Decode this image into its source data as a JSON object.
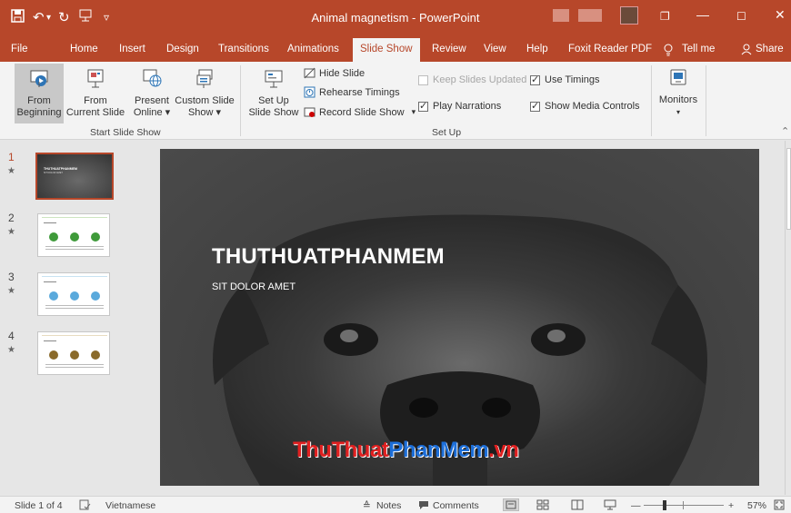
{
  "window": {
    "title": "Animal magnetism  -  PowerPoint",
    "controls": {
      "restore": "❐",
      "minimize": "—",
      "maximize": "☐",
      "close": "✕"
    },
    "qat": {
      "save_icon": "save-icon",
      "undo": "↶",
      "undo_drop": "▾",
      "repeat": "↻",
      "customize": "▿"
    }
  },
  "tabs": [
    {
      "label": "File"
    },
    {
      "label": "Home"
    },
    {
      "label": "Insert"
    },
    {
      "label": "Design"
    },
    {
      "label": "Transitions"
    },
    {
      "label": "Animations"
    },
    {
      "label": "Slide Show",
      "active": true
    },
    {
      "label": "Review"
    },
    {
      "label": "View"
    },
    {
      "label": "Help"
    },
    {
      "label": "Foxit Reader PDF"
    },
    {
      "label": "Tell me"
    },
    {
      "label": "Share"
    }
  ],
  "ribbon": {
    "start_group": {
      "label": "Start Slide Show",
      "from_beginning": {
        "line1": "From",
        "line2": "Beginning"
      },
      "from_current": {
        "line1": "From",
        "line2": "Current Slide"
      },
      "present_online": {
        "line1": "Present",
        "line2": "Online ▾"
      },
      "custom_show": {
        "line1": "Custom Slide",
        "line2": "Show ▾"
      }
    },
    "setup_group": {
      "label": "Set Up",
      "setup_show": {
        "line1": "Set Up",
        "line2": "Slide Show"
      },
      "hide_slide": "Hide Slide",
      "rehearse": "Rehearse Timings",
      "record": "Record Slide Show",
      "record_drop": "▾",
      "keep_updated": "Keep Slides Updated",
      "play_narrations": "Play Narrations",
      "use_timings": "Use Timings",
      "show_media": "Show Media Controls"
    },
    "monitors": {
      "label": "Monitors",
      "drop": "▾"
    },
    "collapse": "⌃"
  },
  "thumbnails": [
    {
      "num": "1",
      "star": "★",
      "current": true,
      "mini_title": "THUTHUATPHANMEM",
      "mini_sub": "SIT DOLOR AMET"
    },
    {
      "num": "2",
      "star": "★",
      "dots": [
        "#3f9a3a",
        "#3f9a3a",
        "#3f9a3a"
      ]
    },
    {
      "num": "3",
      "star": "★",
      "dots": [
        "#5aa9dc",
        "#5aa9dc",
        "#5aa9dc"
      ]
    },
    {
      "num": "4",
      "star": "★",
      "dots": [
        "#8a6a2a",
        "#8a6a2a",
        "#8a6a2a"
      ]
    }
  ],
  "slide": {
    "title": "THUTHUATPHANMEM",
    "subtitle": "SIT DOLOR AMET"
  },
  "watermark": {
    "part1": "ThuThuat",
    "part2": "PhanMem",
    "part3": ".vn"
  },
  "status": {
    "slide_count": "Slide 1 of 4",
    "language": "Vietnamese",
    "notes": "Notes",
    "comments": "Comments",
    "zoom": "57%",
    "zoom_minus": "—",
    "zoom_plus": "+",
    "zoom_level": 0.57
  },
  "colors": {
    "accent": "#b7472a",
    "ribbon_bg": "#f3f3f3",
    "canvas_bg": "#e6e6e6"
  }
}
